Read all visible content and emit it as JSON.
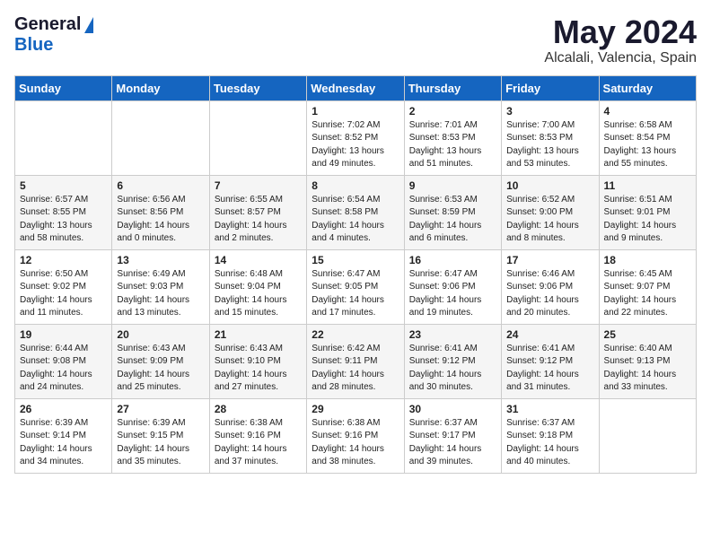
{
  "header": {
    "logo_general": "General",
    "logo_blue": "Blue",
    "month_year": "May 2024",
    "location": "Alcalali, Valencia, Spain"
  },
  "days_of_week": [
    "Sunday",
    "Monday",
    "Tuesday",
    "Wednesday",
    "Thursday",
    "Friday",
    "Saturday"
  ],
  "weeks": [
    [
      {
        "day": "",
        "info": ""
      },
      {
        "day": "",
        "info": ""
      },
      {
        "day": "",
        "info": ""
      },
      {
        "day": "1",
        "info": "Sunrise: 7:02 AM\nSunset: 8:52 PM\nDaylight: 13 hours\nand 49 minutes."
      },
      {
        "day": "2",
        "info": "Sunrise: 7:01 AM\nSunset: 8:53 PM\nDaylight: 13 hours\nand 51 minutes."
      },
      {
        "day": "3",
        "info": "Sunrise: 7:00 AM\nSunset: 8:53 PM\nDaylight: 13 hours\nand 53 minutes."
      },
      {
        "day": "4",
        "info": "Sunrise: 6:58 AM\nSunset: 8:54 PM\nDaylight: 13 hours\nand 55 minutes."
      }
    ],
    [
      {
        "day": "5",
        "info": "Sunrise: 6:57 AM\nSunset: 8:55 PM\nDaylight: 13 hours\nand 58 minutes."
      },
      {
        "day": "6",
        "info": "Sunrise: 6:56 AM\nSunset: 8:56 PM\nDaylight: 14 hours\nand 0 minutes."
      },
      {
        "day": "7",
        "info": "Sunrise: 6:55 AM\nSunset: 8:57 PM\nDaylight: 14 hours\nand 2 minutes."
      },
      {
        "day": "8",
        "info": "Sunrise: 6:54 AM\nSunset: 8:58 PM\nDaylight: 14 hours\nand 4 minutes."
      },
      {
        "day": "9",
        "info": "Sunrise: 6:53 AM\nSunset: 8:59 PM\nDaylight: 14 hours\nand 6 minutes."
      },
      {
        "day": "10",
        "info": "Sunrise: 6:52 AM\nSunset: 9:00 PM\nDaylight: 14 hours\nand 8 minutes."
      },
      {
        "day": "11",
        "info": "Sunrise: 6:51 AM\nSunset: 9:01 PM\nDaylight: 14 hours\nand 9 minutes."
      }
    ],
    [
      {
        "day": "12",
        "info": "Sunrise: 6:50 AM\nSunset: 9:02 PM\nDaylight: 14 hours\nand 11 minutes."
      },
      {
        "day": "13",
        "info": "Sunrise: 6:49 AM\nSunset: 9:03 PM\nDaylight: 14 hours\nand 13 minutes."
      },
      {
        "day": "14",
        "info": "Sunrise: 6:48 AM\nSunset: 9:04 PM\nDaylight: 14 hours\nand 15 minutes."
      },
      {
        "day": "15",
        "info": "Sunrise: 6:47 AM\nSunset: 9:05 PM\nDaylight: 14 hours\nand 17 minutes."
      },
      {
        "day": "16",
        "info": "Sunrise: 6:47 AM\nSunset: 9:06 PM\nDaylight: 14 hours\nand 19 minutes."
      },
      {
        "day": "17",
        "info": "Sunrise: 6:46 AM\nSunset: 9:06 PM\nDaylight: 14 hours\nand 20 minutes."
      },
      {
        "day": "18",
        "info": "Sunrise: 6:45 AM\nSunset: 9:07 PM\nDaylight: 14 hours\nand 22 minutes."
      }
    ],
    [
      {
        "day": "19",
        "info": "Sunrise: 6:44 AM\nSunset: 9:08 PM\nDaylight: 14 hours\nand 24 minutes."
      },
      {
        "day": "20",
        "info": "Sunrise: 6:43 AM\nSunset: 9:09 PM\nDaylight: 14 hours\nand 25 minutes."
      },
      {
        "day": "21",
        "info": "Sunrise: 6:43 AM\nSunset: 9:10 PM\nDaylight: 14 hours\nand 27 minutes."
      },
      {
        "day": "22",
        "info": "Sunrise: 6:42 AM\nSunset: 9:11 PM\nDaylight: 14 hours\nand 28 minutes."
      },
      {
        "day": "23",
        "info": "Sunrise: 6:41 AM\nSunset: 9:12 PM\nDaylight: 14 hours\nand 30 minutes."
      },
      {
        "day": "24",
        "info": "Sunrise: 6:41 AM\nSunset: 9:12 PM\nDaylight: 14 hours\nand 31 minutes."
      },
      {
        "day": "25",
        "info": "Sunrise: 6:40 AM\nSunset: 9:13 PM\nDaylight: 14 hours\nand 33 minutes."
      }
    ],
    [
      {
        "day": "26",
        "info": "Sunrise: 6:39 AM\nSunset: 9:14 PM\nDaylight: 14 hours\nand 34 minutes."
      },
      {
        "day": "27",
        "info": "Sunrise: 6:39 AM\nSunset: 9:15 PM\nDaylight: 14 hours\nand 35 minutes."
      },
      {
        "day": "28",
        "info": "Sunrise: 6:38 AM\nSunset: 9:16 PM\nDaylight: 14 hours\nand 37 minutes."
      },
      {
        "day": "29",
        "info": "Sunrise: 6:38 AM\nSunset: 9:16 PM\nDaylight: 14 hours\nand 38 minutes."
      },
      {
        "day": "30",
        "info": "Sunrise: 6:37 AM\nSunset: 9:17 PM\nDaylight: 14 hours\nand 39 minutes."
      },
      {
        "day": "31",
        "info": "Sunrise: 6:37 AM\nSunset: 9:18 PM\nDaylight: 14 hours\nand 40 minutes."
      },
      {
        "day": "",
        "info": ""
      }
    ]
  ]
}
